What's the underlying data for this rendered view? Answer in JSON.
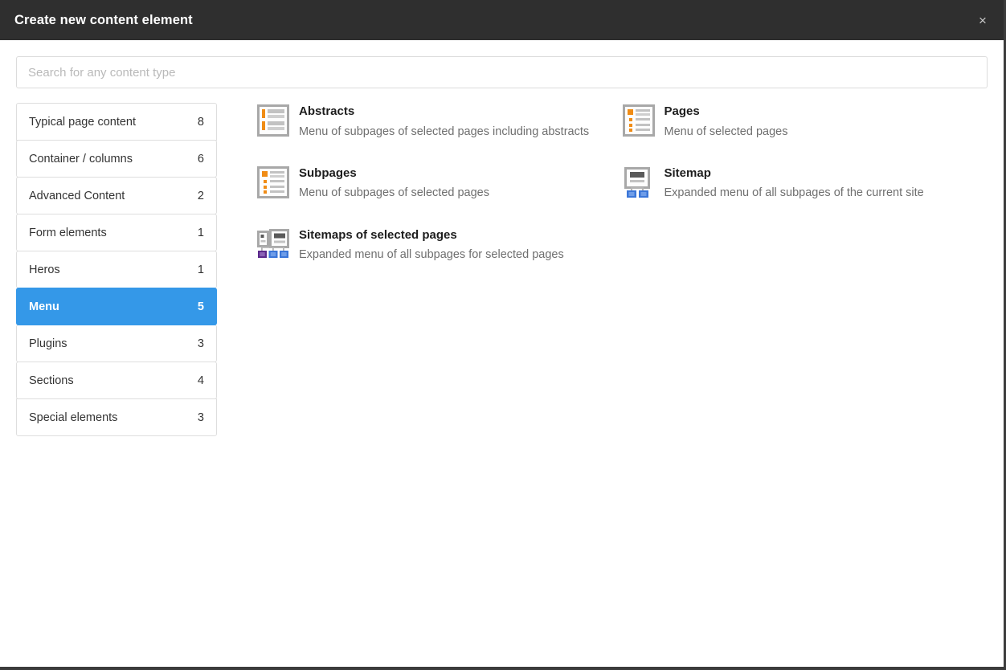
{
  "header": {
    "title": "Create new content element",
    "close_label": "×",
    "close_icon": "close-icon"
  },
  "search": {
    "placeholder": "Search for any content type",
    "value": ""
  },
  "colors": {
    "header_background": "#2f2f2f",
    "active_category": "#3498e8",
    "icon_orange": "#f08c15",
    "icon_blue": "#3b76d8",
    "icon_purple": "#5b2a8c",
    "icon_gray": "#b4b4b4"
  },
  "sidebar": {
    "items": [
      {
        "label": "Typical page content",
        "count": "8",
        "active": false
      },
      {
        "label": "Container / columns",
        "count": "6",
        "active": false
      },
      {
        "label": "Advanced Content",
        "count": "2",
        "active": false
      },
      {
        "label": "Form elements",
        "count": "1",
        "active": false
      },
      {
        "label": "Heros",
        "count": "1",
        "active": false
      },
      {
        "label": "Menu",
        "count": "5",
        "active": true
      },
      {
        "label": "Plugins",
        "count": "3",
        "active": false
      },
      {
        "label": "Sections",
        "count": "4",
        "active": false
      },
      {
        "label": "Special elements",
        "count": "3",
        "active": false
      }
    ]
  },
  "main": {
    "items": [
      {
        "title": "Abstracts",
        "description": "Menu of subpages of selected pages including abstracts",
        "icon": "abstracts-icon"
      },
      {
        "title": "Pages",
        "description": "Menu of selected pages",
        "icon": "pages-icon"
      },
      {
        "title": "Subpages",
        "description": "Menu of subpages of selected pages",
        "icon": "subpages-icon"
      },
      {
        "title": "Sitemap",
        "description": "Expanded menu of all subpages of the current site",
        "icon": "sitemap-icon"
      },
      {
        "title": "Sitemaps of selected pages",
        "description": "Expanded menu of all subpages for selected pages",
        "icon": "sitemaps-selected-icon"
      }
    ]
  }
}
